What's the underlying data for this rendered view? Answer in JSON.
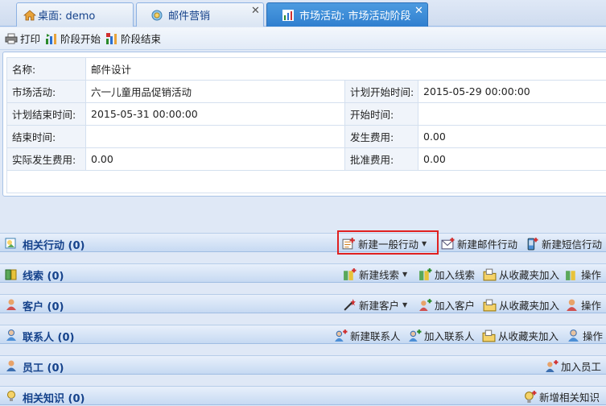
{
  "tabs": [
    {
      "label": "桌面: demo",
      "icon": "home-icon",
      "closable": false
    },
    {
      "label": "邮件营销",
      "icon": "campaign-icon",
      "closable": true
    },
    {
      "label": "市场活动: 市场活动阶段",
      "icon": "chart-icon",
      "closable": true,
      "active": true
    }
  ],
  "toolbar": {
    "print_label": "打印",
    "stage_start_label": "阶段开始",
    "stage_end_label": "阶段结束"
  },
  "detail": {
    "name_label": "名称:",
    "name_value": "邮件设计",
    "campaign_label": "市场活动:",
    "campaign_value": "六一儿童用品促销活动",
    "plan_start_label": "计划开始时间:",
    "plan_start_value": "2015-05-29 00:00:00",
    "plan_end_label": "计划结束时间:",
    "plan_end_value": "2015-05-31 00:00:00",
    "start_label": "开始时间:",
    "start_value": "",
    "end_label": "结束时间:",
    "end_value": "",
    "cost_label": "发生费用:",
    "cost_value": "0.00",
    "actual_cost_label": "实际发生费用:",
    "actual_cost_value": "0.00",
    "approved_cost_label": "批准费用:",
    "approved_cost_value": "0.00"
  },
  "sections": {
    "actions": {
      "title": "相关行动 (0)",
      "new_general": "新建一般行动",
      "new_email": "新建邮件行动",
      "new_sms": "新建短信行动"
    },
    "leads": {
      "title": "线索 (0)",
      "new": "新建线索",
      "add": "加入线索",
      "from_fav": "从收藏夹加入",
      "op": "操作"
    },
    "customers": {
      "title": "客户 (0)",
      "new": "新建客户",
      "add": "加入客户",
      "from_fav": "从收藏夹加入",
      "op": "操作"
    },
    "contacts": {
      "title": "联系人 (0)",
      "new": "新建联系人",
      "add": "加入联系人",
      "from_fav": "从收藏夹加入",
      "op": "操作"
    },
    "employees": {
      "title": "员工 (0)",
      "add": "加入员工"
    },
    "knowledge": {
      "title": "相关知识 (0)",
      "new": "新增相关知识"
    }
  },
  "colors": {
    "accent": "#2f7fcf",
    "section_title": "#15428b",
    "highlight": "#e02020"
  }
}
